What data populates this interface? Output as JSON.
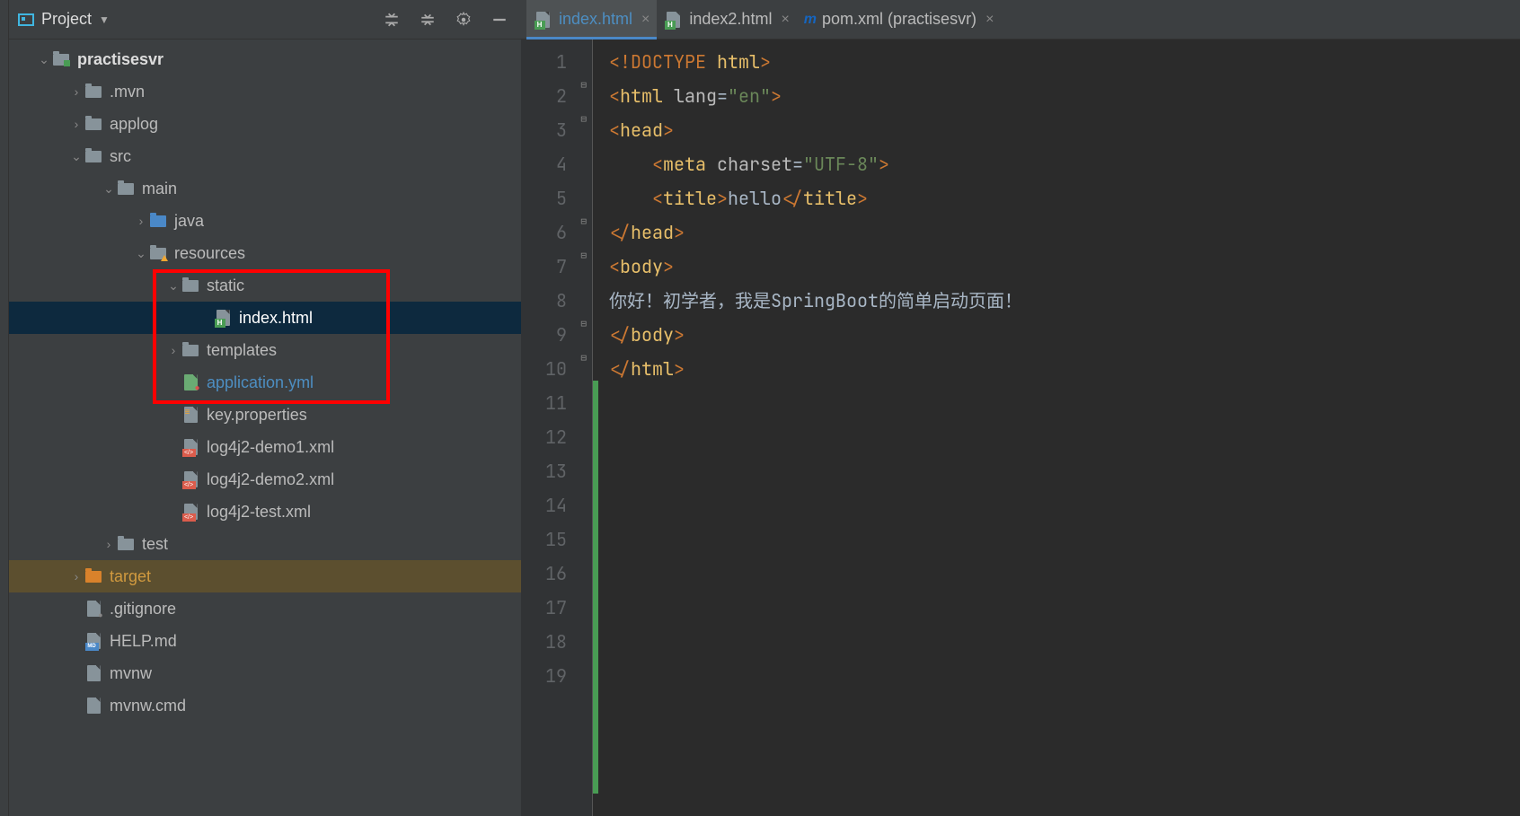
{
  "project_panel": {
    "title": "Project"
  },
  "tree": {
    "root": "practisesvr",
    "mvn": ".mvn",
    "applog": "applog",
    "src": "src",
    "main": "main",
    "java": "java",
    "resources": "resources",
    "static": "static",
    "index_html": "index.html",
    "templates": "templates",
    "application_yml": "application.yml",
    "key_properties": "key.properties",
    "log4j2_demo1": "log4j2-demo1.xml",
    "log4j2_demo2": "log4j2-demo2.xml",
    "log4j2_test": "log4j2-test.xml",
    "test": "test",
    "target": "target",
    "gitignore": ".gitignore",
    "help_md": "HELP.md",
    "mvnw": "mvnw",
    "mvnw_cmd": "mvnw.cmd"
  },
  "tabs": {
    "t1": "index.html",
    "t2": "index2.html",
    "t3": "pom.xml (practisesvr)"
  },
  "code": {
    "l1_a": "<!",
    "l1_b": "DOCTYPE ",
    "l1_c": "html",
    "l1_d": ">",
    "l2_a": "<",
    "l2_b": "html ",
    "l2_c": "lang",
    "l2_d": "=",
    "l2_e": "\"en\"",
    "l2_f": ">",
    "l3_a": "<",
    "l3_b": "head",
    "l3_c": ">",
    "l4_a": "    <",
    "l4_b": "meta ",
    "l4_c": "charset",
    "l4_d": "=",
    "l4_e": "\"UTF-8\"",
    "l4_f": ">",
    "l5_a": "    <",
    "l5_b": "title",
    "l5_c": ">",
    "l5_d": "hello",
    "l5_e": "</",
    "l5_f": "title",
    "l5_g": ">",
    "l6_a": "</",
    "l6_b": "head",
    "l6_c": ">",
    "l7_a": "<",
    "l7_b": "body",
    "l7_c": ">",
    "l8": "你好！初学者，我是SpringBoot的简单启动页面！",
    "l9_a": "</",
    "l9_b": "body",
    "l9_c": ">",
    "l10_a": "</",
    "l10_b": "html",
    "l10_c": ">"
  },
  "lines": {
    "n1": "1",
    "n2": "2",
    "n3": "3",
    "n4": "4",
    "n5": "5",
    "n6": "6",
    "n7": "7",
    "n8": "8",
    "n9": "9",
    "n10": "10",
    "n11": "11",
    "n12": "12",
    "n13": "13",
    "n14": "14",
    "n15": "15",
    "n16": "16",
    "n17": "17",
    "n18": "18",
    "n19": "19"
  }
}
